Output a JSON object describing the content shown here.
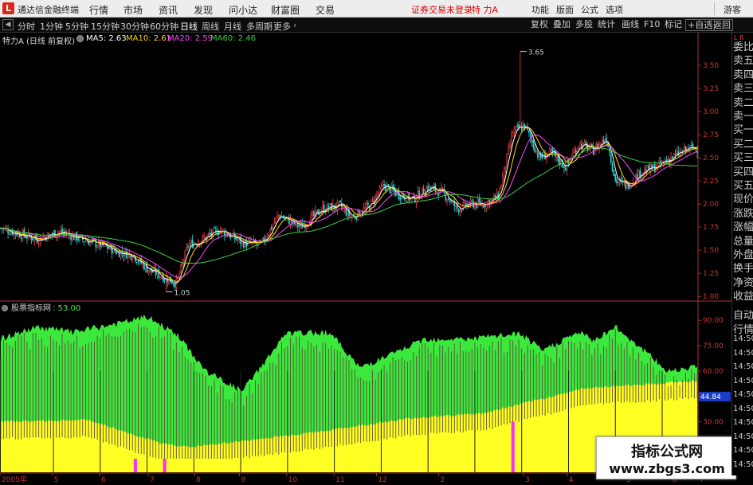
{
  "titlebar": {
    "app_title": "通达信金融终端",
    "menu": [
      "行情",
      "市场",
      "资讯",
      "发现",
      "问小达",
      "财富圈",
      "交易"
    ],
    "status": "证券交易未登录",
    "stock": "特 力A",
    "right_menu": [
      "功能",
      "版面",
      "公式",
      "选项"
    ],
    "guest": "游客"
  },
  "toolbar": {
    "periods": [
      "分时",
      "1分钟",
      "5分钟",
      "15分钟",
      "30分钟",
      "60分钟",
      "日线",
      "周线",
      "月线",
      "多周期",
      "更多"
    ],
    "active_period": "日线",
    "right_buttons": [
      "复权",
      "叠加",
      "多股",
      "统计",
      "画线",
      "F10",
      "标记",
      "+自选",
      "返回"
    ]
  },
  "legend": {
    "stock_label": "特力A (日线 前复权)",
    "ma5": "MA5: 2.63",
    "ma10": "MA10: 2.61",
    "ma20": "MA20: 2.59",
    "ma60": "MA60: 2.46"
  },
  "price_axis": {
    "ticks": [
      "3.50",
      "3.25",
      "3.00",
      "2.75",
      "2.50",
      "2.25",
      "2.00",
      "1.75",
      "1.50",
      "1.25",
      "1.00"
    ],
    "high_label": "3.65",
    "low_label": "1.05"
  },
  "indicator": {
    "name": "股票指标网",
    "value": ": 53.00",
    "ticks": [
      "90.00",
      "75.00",
      "60.00",
      "45.00",
      "30.00"
    ],
    "current": "44.84"
  },
  "date_axis": [
    "2005年",
    "5",
    "6",
    "7",
    "8",
    "9",
    "10",
    "11",
    "12",
    "2",
    "3",
    "4",
    "5",
    "6",
    "7"
  ],
  "right_panel": {
    "tag": "L R",
    "items": [
      "委比",
      "卖五",
      "卖四",
      "卖三",
      "卖二",
      "卖一",
      "买一",
      "买二",
      "买三",
      "买四",
      "买五",
      "现价",
      "涨跌",
      "涨幅",
      "总量",
      "外盘",
      "换手",
      "净资",
      "收益"
    ],
    "lower_items": [
      "自动",
      "行情",
      "14:50",
      "14:50",
      "14:50",
      "14:50",
      "14:50",
      "14:50",
      "14:50",
      "14:50",
      "14:50",
      "14:50"
    ]
  },
  "watermark": {
    "title": "指标公式网",
    "url": "www.zbgs3.com"
  },
  "chart_data": [
    {
      "type": "candlestick",
      "title": "特力A (日线 前复权)",
      "ylim": [
        0.95,
        3.75
      ],
      "yticks": [
        1.0,
        1.25,
        1.5,
        1.75,
        2.0,
        2.25,
        2.5,
        2.75,
        3.0,
        3.25,
        3.5
      ],
      "anchors": [
        [
          0,
          1.74
        ],
        [
          12,
          1.68
        ],
        [
          25,
          1.62
        ],
        [
          40,
          1.7
        ],
        [
          55,
          1.62
        ],
        [
          70,
          1.55
        ],
        [
          80,
          1.48
        ],
        [
          90,
          1.45
        ],
        [
          100,
          1.3
        ],
        [
          110,
          1.22
        ],
        [
          120,
          1.14
        ],
        [
          128,
          1.55
        ],
        [
          138,
          1.62
        ],
        [
          150,
          1.72
        ],
        [
          165,
          1.58
        ],
        [
          178,
          1.56
        ],
        [
          190,
          1.88
        ],
        [
          205,
          1.75
        ],
        [
          220,
          1.95
        ],
        [
          232,
          1.98
        ],
        [
          240,
          1.85
        ],
        [
          252,
          1.98
        ],
        [
          262,
          2.2
        ],
        [
          272,
          2.1
        ],
        [
          282,
          2.05
        ],
        [
          292,
          2.18
        ],
        [
          302,
          2.12
        ],
        [
          312,
          1.95
        ],
        [
          322,
          2.0
        ],
        [
          330,
          2.0
        ],
        [
          340,
          2.08
        ],
        [
          350,
          2.78
        ],
        [
          358,
          2.85
        ],
        [
          368,
          2.5
        ],
        [
          376,
          2.55
        ],
        [
          386,
          2.4
        ],
        [
          395,
          2.65
        ],
        [
          405,
          2.58
        ],
        [
          414,
          2.72
        ],
        [
          420,
          2.25
        ],
        [
          428,
          2.2
        ],
        [
          438,
          2.35
        ],
        [
          448,
          2.4
        ],
        [
          458,
          2.5
        ],
        [
          470,
          2.6
        ],
        [
          476,
          2.6
        ]
      ],
      "series_names": [
        "MA5",
        "MA10",
        "MA20",
        "MA60"
      ],
      "series_colors": [
        "#ffffff",
        "#ffd700",
        "#ff44ff",
        "#3ed13e"
      ],
      "high": {
        "value": 3.65,
        "index": 355
      },
      "low": {
        "value": 1.05,
        "index": 113
      }
    },
    {
      "type": "area",
      "title": "股票指标网",
      "ylim": [
        0,
        100
      ],
      "yticks": [
        30,
        45,
        60,
        75,
        90
      ],
      "current": 44.84,
      "yellow_anchors": [
        [
          0,
          30
        ],
        [
          60,
          31
        ],
        [
          110,
          17
        ],
        [
          130,
          15
        ],
        [
          170,
          19
        ],
        [
          225,
          25
        ],
        [
          280,
          32
        ],
        [
          330,
          35
        ],
        [
          400,
          50
        ],
        [
          476,
          54
        ]
      ],
      "green_anchors": [
        [
          0,
          79
        ],
        [
          25,
          86
        ],
        [
          50,
          83
        ],
        [
          80,
          88
        ],
        [
          100,
          92
        ],
        [
          120,
          82
        ],
        [
          140,
          60
        ],
        [
          165,
          48
        ],
        [
          195,
          82
        ],
        [
          225,
          83
        ],
        [
          245,
          62
        ],
        [
          265,
          69
        ],
        [
          290,
          79
        ],
        [
          320,
          79
        ],
        [
          355,
          82
        ],
        [
          370,
          72
        ],
        [
          395,
          83
        ],
        [
          405,
          78
        ],
        [
          420,
          86
        ],
        [
          440,
          72
        ],
        [
          455,
          60
        ],
        [
          476,
          63
        ]
      ],
      "magenta_marks": [
        [
          92,
          8
        ],
        [
          112,
          8
        ],
        [
          350,
          30
        ]
      ]
    }
  ]
}
